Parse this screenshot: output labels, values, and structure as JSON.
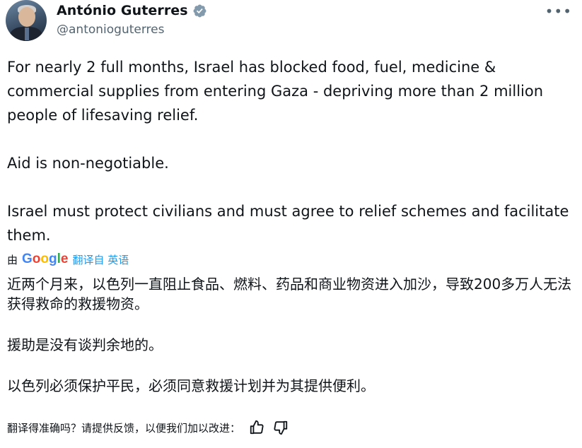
{
  "author": {
    "name": "António Guterres",
    "handle": "@antonioguterres"
  },
  "tweet": {
    "paragraphs": [
      "For nearly 2 full months, Israel has blocked food, fuel, medicine & commercial supplies from entering Gaza - depriving more than 2 million people of lifesaving relief.",
      "Aid is non-negotiable.",
      "Israel must protect civilians and must agree to relief schemes and facilitate them."
    ]
  },
  "translation": {
    "by_label": "由",
    "provider": "Google",
    "link_text": "翻译自 英语",
    "paragraphs": [
      "近两个月来，以色列一直阻止食品、燃料、药品和商业物资进入加沙，导致200多万人无法获得救命的救援物资。",
      "援助是没有谈判余地的。",
      "以色列必须保护平民，必须同意救援计划并为其提供便利。"
    ],
    "feedback_prompt": "翻译得准确吗？请提供反馈，以便我们加以改进："
  },
  "icons": {
    "verified": "verified-badge-icon",
    "more": "more-options-icon",
    "thumbs_up": "thumbs-up-icon",
    "thumbs_down": "thumbs-down-icon"
  },
  "colors": {
    "verified_badge": "#829aab",
    "link": "#1d9bf0",
    "secondary_text": "#536471"
  }
}
